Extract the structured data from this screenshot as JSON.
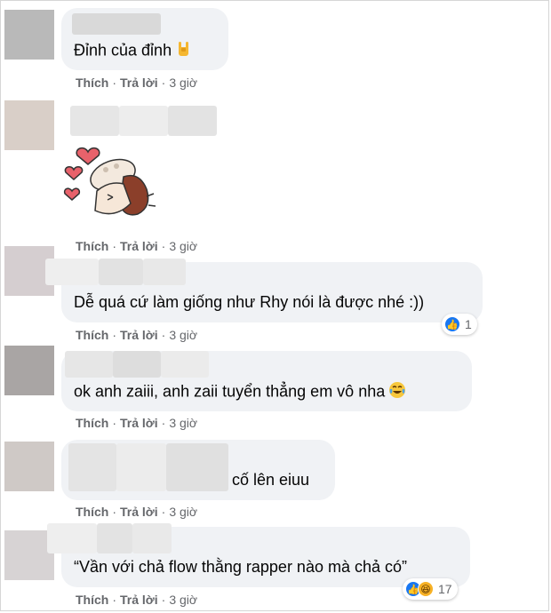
{
  "comments": [
    {
      "text": "Đỉnh của đỉnh",
      "emoji": "sign-of-horns-emoji",
      "actions": {
        "like": "Thích",
        "reply": "Trả lời",
        "sep": "·",
        "time": "3 giờ"
      }
    },
    {
      "text": "",
      "sticker": "mushroom-hearts-sticker",
      "actions": {
        "like": "Thích",
        "reply": "Trả lời",
        "sep": "·",
        "time": "3 giờ"
      }
    },
    {
      "text": "Dễ quá cứ làm giống như Rhy nói là được nhé :))",
      "reactions": {
        "types": [
          "like"
        ],
        "count": "1"
      },
      "actions": {
        "like": "Thích",
        "reply": "Trả lời",
        "sep": "·",
        "time": "3 giờ"
      }
    },
    {
      "text": "ok anh zaiii, anh zaii tuyển thẳng em vô nha",
      "emoji": "tears-of-joy-emoji",
      "actions": {
        "like": "Thích",
        "reply": "Trả lời",
        "sep": "·",
        "time": "3 giờ"
      }
    },
    {
      "text": "cố lên eiuu",
      "actions": {
        "like": "Thích",
        "reply": "Trả lời",
        "sep": "·",
        "time": "3 giờ"
      }
    },
    {
      "text": "“Vần với chả flow thằng rapper nào mà chả có”",
      "reactions": {
        "types": [
          "like",
          "haha"
        ],
        "count": "17"
      },
      "actions": {
        "like": "Thích",
        "reply": "Trả lời",
        "sep": "·",
        "time": "3 giờ"
      }
    }
  ],
  "colors": {
    "bubble": "#f0f2f5",
    "action_text": "#65676b",
    "like_blue": "#1877f2",
    "haha_yellow": "#f7b125"
  }
}
